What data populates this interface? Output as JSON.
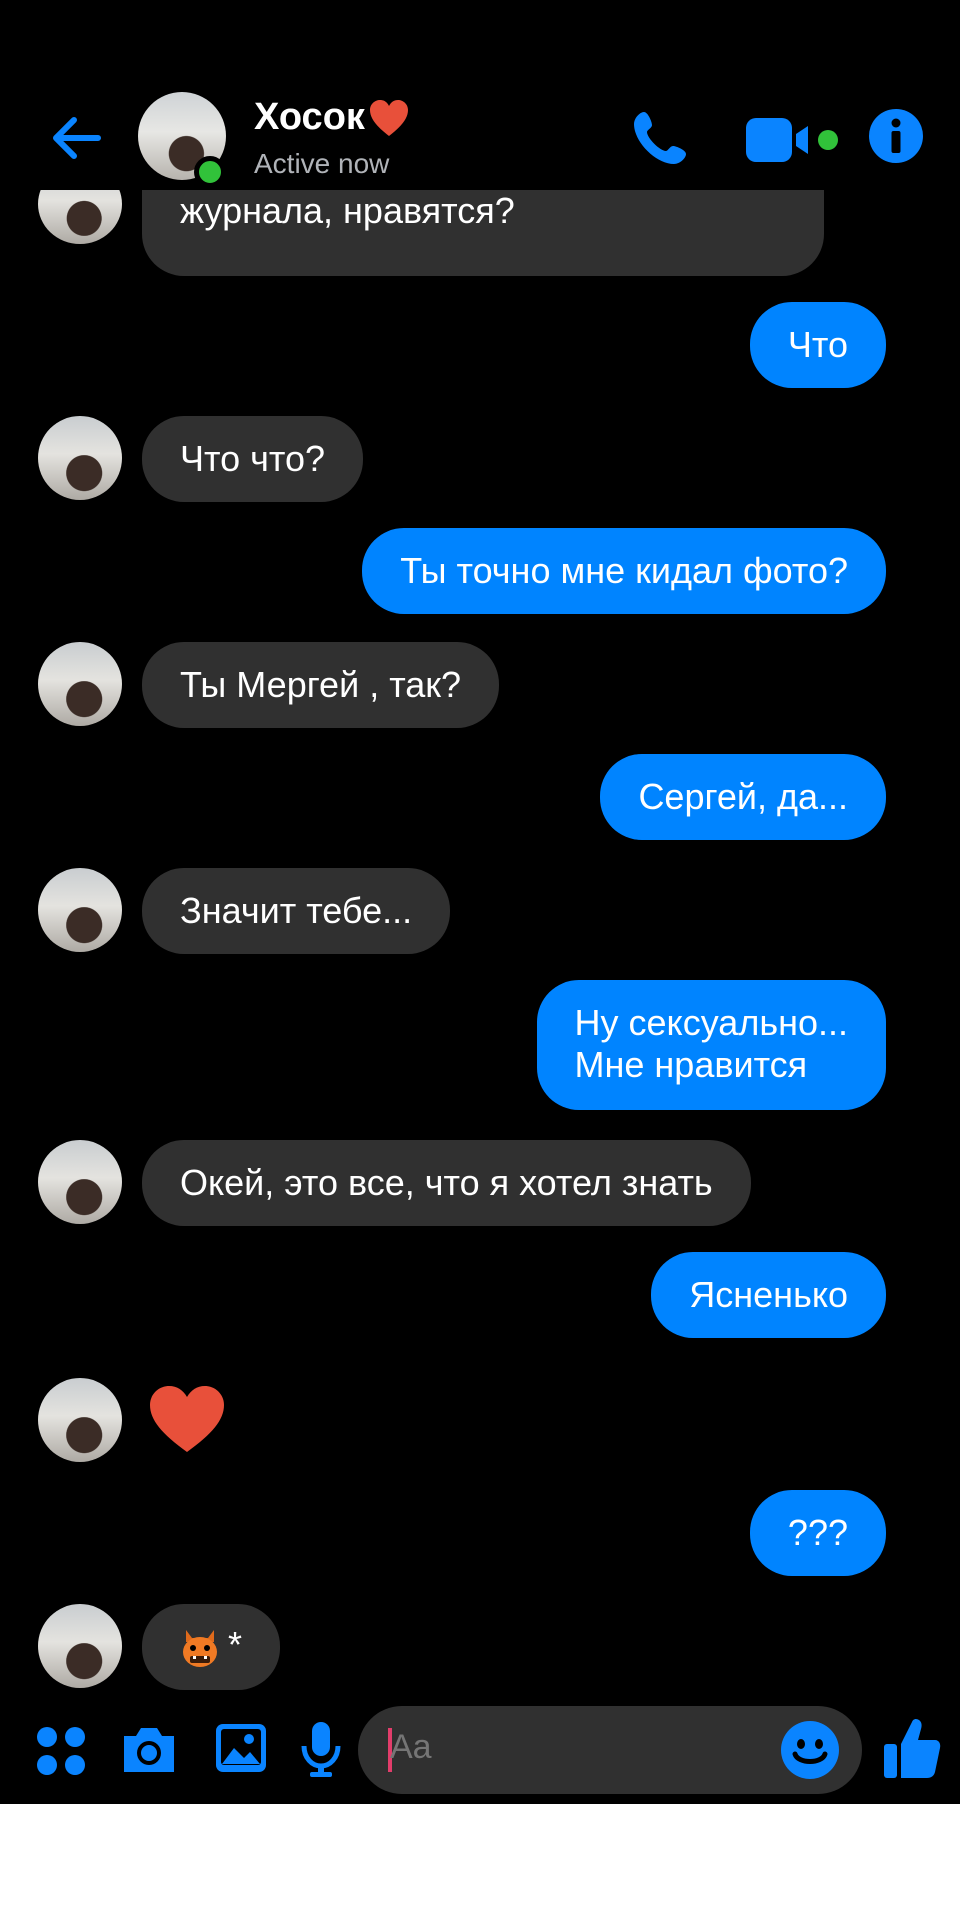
{
  "header": {
    "contact_name": "Хосок",
    "status": "Active now"
  },
  "messages": [
    {
      "from": "them",
      "text": "журнала, нравятся?"
    },
    {
      "from": "me",
      "text": "Что"
    },
    {
      "from": "them",
      "text": "Что что?"
    },
    {
      "from": "me",
      "text": "Ты точно мне кидал фото?"
    },
    {
      "from": "them",
      "text": "Ты Мергей , так?"
    },
    {
      "from": "me",
      "text": "Сергей, да..."
    },
    {
      "from": "them",
      "text": "Значит тебе..."
    },
    {
      "from": "me",
      "line1": "Ну сексуально...",
      "line2": "Мне нравится"
    },
    {
      "from": "them",
      "text": "Окей, это все, что я хотел знать"
    },
    {
      "from": "me",
      "text": "Ясненько"
    },
    {
      "from": "them",
      "type": "heart-reaction"
    },
    {
      "from": "me",
      "text": "???"
    },
    {
      "from": "them",
      "text": "*",
      "emoji": "oni-mask-icon"
    }
  ],
  "composer": {
    "placeholder": "Aa"
  },
  "colors": {
    "accent": "#0084ff",
    "incoming_bubble": "#303030",
    "background": "#000000",
    "presence": "#31c23a",
    "heart": "#e8503a"
  }
}
